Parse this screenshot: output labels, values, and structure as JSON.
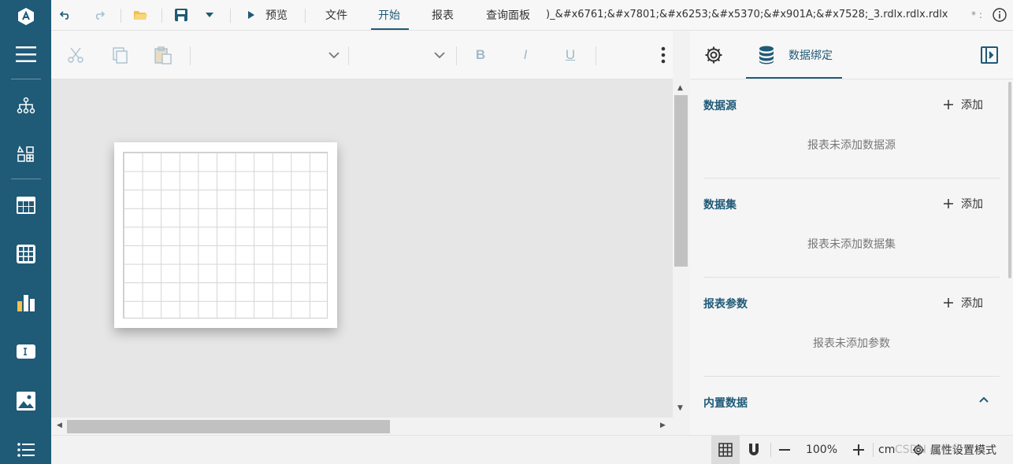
{
  "sidebar": {
    "items": [
      {
        "icon": "app-logo-icon"
      },
      {
        "icon": "menu-icon"
      },
      {
        "icon": "tree-structure-icon"
      },
      {
        "icon": "components-icon"
      },
      {
        "icon": "table-icon"
      },
      {
        "icon": "matrix-icon"
      },
      {
        "icon": "bar-chart-icon"
      },
      {
        "icon": "textbox-icon"
      },
      {
        "icon": "image-icon"
      },
      {
        "icon": "list-icon"
      }
    ],
    "color": "#1f5a77"
  },
  "menubar": {
    "preview_label": "预览",
    "tabs": [
      "文件",
      "开始",
      "报表",
      "查询面板"
    ],
    "active_tab": "开始",
    "filename": ")_&#x6761;&#x7801;&#x6253;&#x5370;&#x901A;&#x7528;_3.rdlx.rdlx.rdlx",
    "dirty_marker": "* :"
  },
  "toolbar": {
    "bold_label": "B",
    "italic_label": "I",
    "underline_label": "U"
  },
  "panel": {
    "tab_label": "数据绑定",
    "add_label": "添加",
    "sections": [
      {
        "title": "数据源",
        "empty": "报表未添加数据源"
      },
      {
        "title": "数据集",
        "empty": "报表未添加数据集"
      },
      {
        "title": "报表参数",
        "empty": "报表未添加参数"
      }
    ],
    "builtin_title": "内置数据"
  },
  "statusbar": {
    "zoom": "100%",
    "unit": "cm",
    "property_mode": "属性设置模式"
  },
  "watermark": "CSDN @中华",
  "colors": {
    "accent": "#1f5a77",
    "disabled_icon": "#a9c1d1"
  }
}
